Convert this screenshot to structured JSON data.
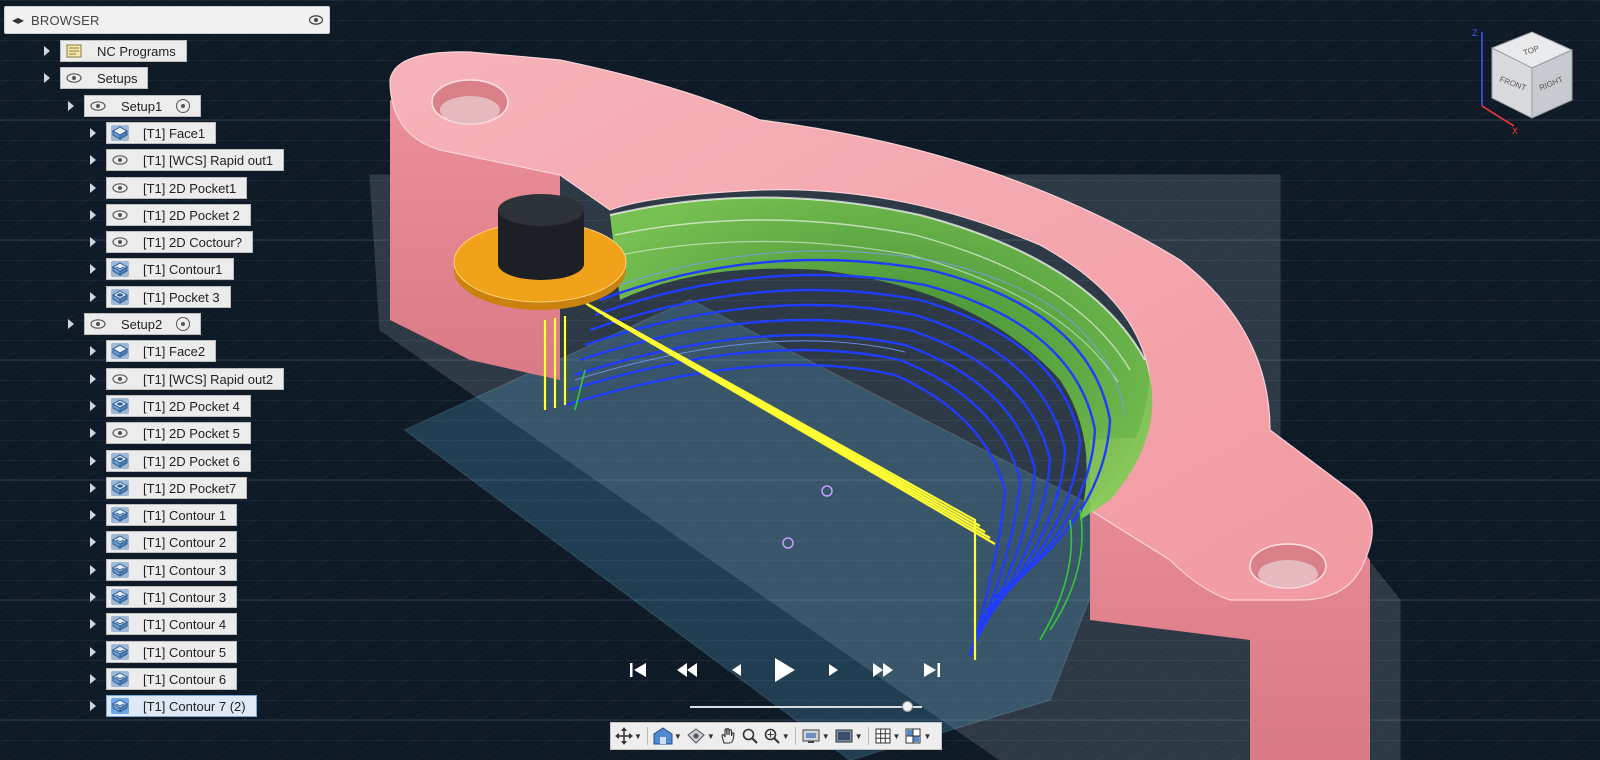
{
  "browser": {
    "title": "BROWSER"
  },
  "tree": [
    {
      "label": "NC Programs",
      "icon": "nc-programs-icon",
      "level": 0
    },
    {
      "label": "Setups",
      "icon": "visibility-eye-icon",
      "level": 0
    },
    {
      "label": "Setup1",
      "icon": "visibility-eye-icon",
      "level": 1,
      "activate": true
    },
    {
      "label": "[T1] Face1",
      "icon": "face-operation-icon",
      "level": 2
    },
    {
      "label": "[T1] [WCS] Rapid out1",
      "icon": "visibility-eye-icon",
      "level": 2
    },
    {
      "label": "[T1] 2D Pocket1",
      "icon": "visibility-eye-icon",
      "level": 2
    },
    {
      "label": "[T1] 2D Pocket 2",
      "icon": "visibility-eye-icon",
      "level": 2
    },
    {
      "label": "[T1] 2D Coctour?",
      "icon": "visibility-eye-icon",
      "level": 2
    },
    {
      "label": "[T1] Contour1",
      "icon": "contour-operation-icon",
      "level": 2
    },
    {
      "label": "[T1] Pocket 3",
      "icon": "pocket-operation-icon",
      "level": 2
    },
    {
      "label": "Setup2",
      "icon": "visibility-eye-icon",
      "level": 1,
      "activate": true
    },
    {
      "label": "[T1] Face2",
      "icon": "face-operation-icon",
      "level": 2
    },
    {
      "label": "[T1] [WCS] Rapid out2",
      "icon": "visibility-eye-icon",
      "level": 2
    },
    {
      "label": "[T1] 2D Pocket 4",
      "icon": "pocket-operation-icon",
      "level": 2
    },
    {
      "label": "[T1] 2D Pocket 5",
      "icon": "visibility-eye-icon",
      "level": 2
    },
    {
      "label": "[T1] 2D Pocket 6",
      "icon": "pocket-operation-icon",
      "level": 2
    },
    {
      "label": "[T1] 2D Pocket7",
      "icon": "pocket-operation-icon",
      "level": 2
    },
    {
      "label": "[T1] Contour 1",
      "icon": "contour-operation-icon",
      "level": 2
    },
    {
      "label": "[T1] Contour 2",
      "icon": "contour-operation-icon",
      "level": 2
    },
    {
      "label": "[T1] Contour 3",
      "icon": "contour-operation-icon",
      "level": 2
    },
    {
      "label": "[T1] Contour 3",
      "icon": "contour-operation-icon",
      "level": 2
    },
    {
      "label": "[T1] Contour 4",
      "icon": "contour-operation-icon",
      "level": 2
    },
    {
      "label": "[T1] Contour 5",
      "icon": "contour-operation-icon",
      "level": 2
    },
    {
      "label": "[T1] Contour 6",
      "icon": "contour-operation-icon",
      "level": 2
    },
    {
      "label": "[T1] Contour 7 (2)",
      "icon": "contour-operation-icon",
      "level": 2,
      "selected": true
    }
  ],
  "view_cube": {
    "top": "TOP",
    "front": "FRONT",
    "right": "RIGHT",
    "axis_z": "Z",
    "axis_x": "X"
  },
  "simulation": {
    "buttons": [
      "go-to-start-button",
      "step-back-multiple-button",
      "step-back-button",
      "play-button",
      "step-forward-button",
      "step-forward-multiple-button",
      "go-to-end-button"
    ],
    "progress": 0.96
  },
  "colors": {
    "background": "#0f1a27",
    "part": "#f2a3aa",
    "toolpath_blue": "#1f3cff",
    "toolpath_yellow": "#ffff33",
    "toolpath_green": "#33cc33",
    "tool_holder": "#f0a21a",
    "stock_plane": "#7fd4ff"
  }
}
